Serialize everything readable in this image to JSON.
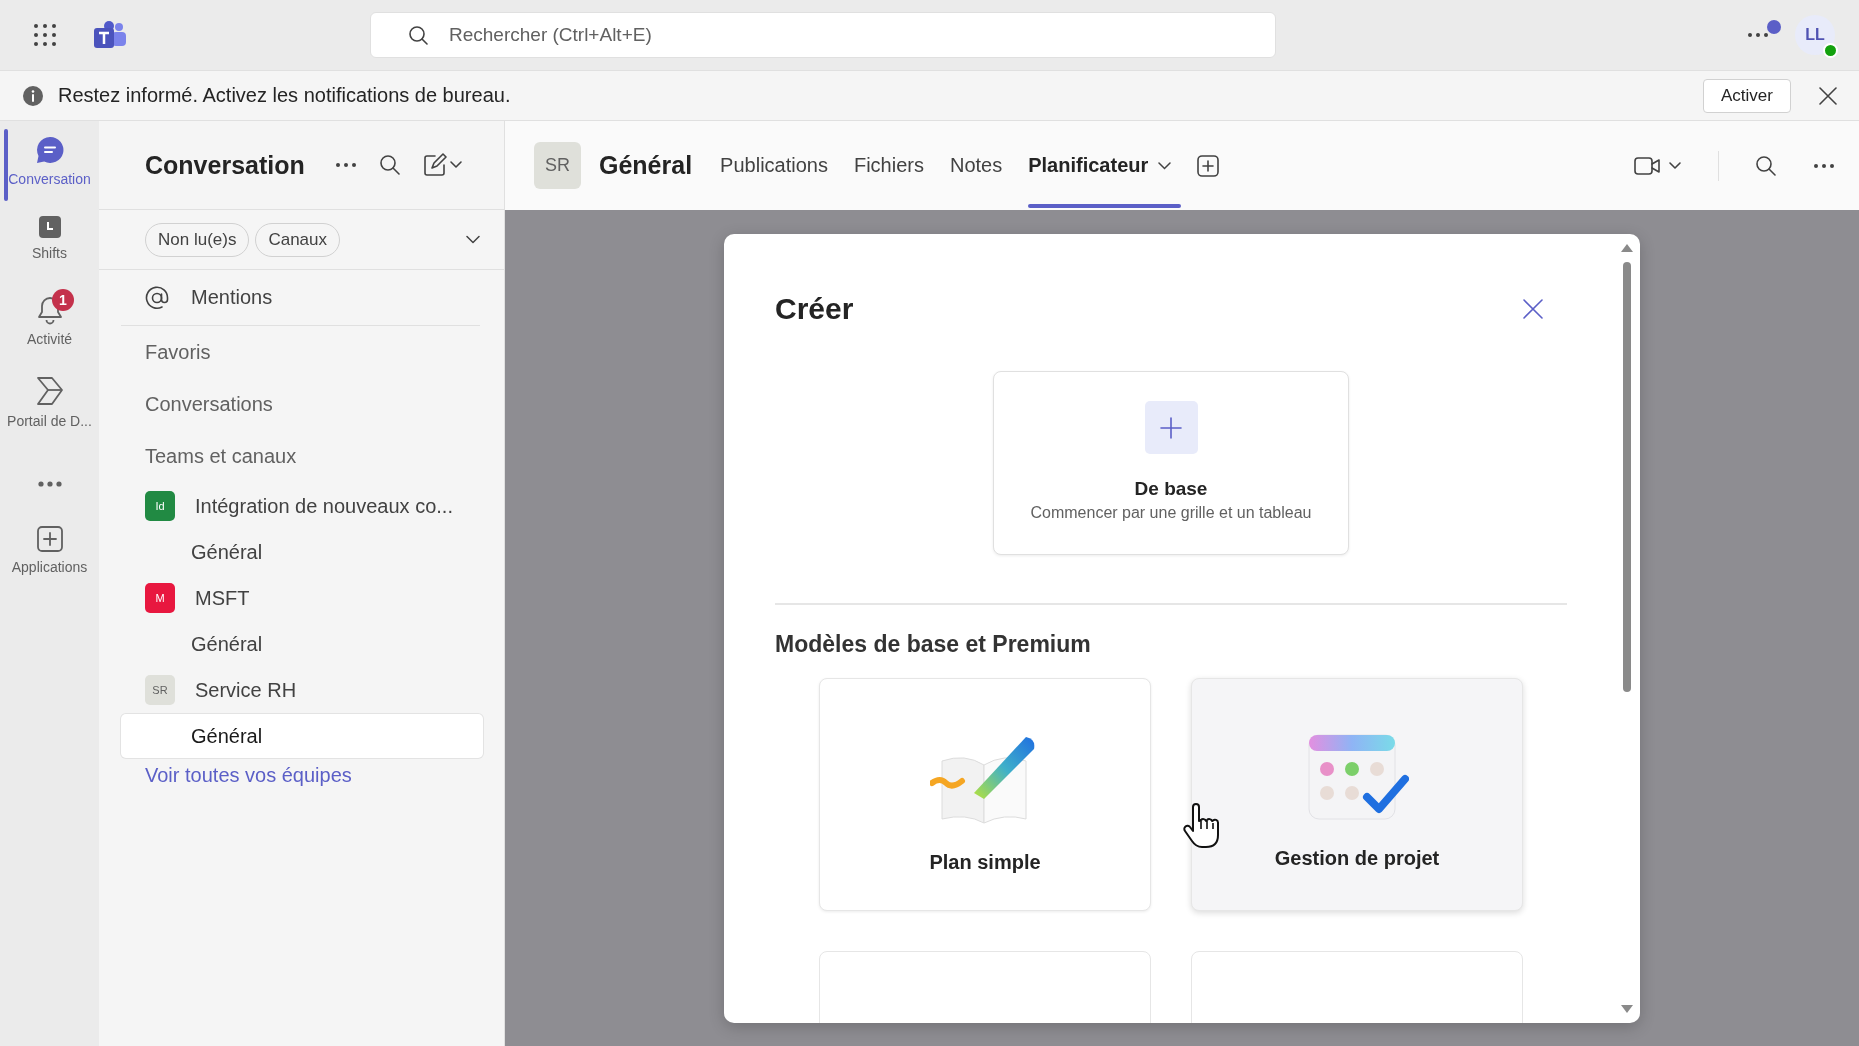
{
  "topbar": {
    "search": {
      "placeholder": "Rechercher (Ctrl+Alt+E)"
    },
    "more_unread": true,
    "avatar": {
      "initials": "LL",
      "online": true
    }
  },
  "notification": {
    "text": "Restez informé. Activez les notifications de bureau.",
    "button": "Activer"
  },
  "rail": [
    {
      "kind": "chat",
      "label": "Conversation",
      "selected": true
    },
    {
      "kind": "shifts",
      "label": "Shifts",
      "selected": false
    },
    {
      "kind": "activity",
      "label": "Activité",
      "selected": false,
      "badge": "1"
    },
    {
      "kind": "portal",
      "label": "Portail de D...",
      "selected": false
    },
    {
      "kind": "more",
      "selected": false
    },
    {
      "kind": "apps",
      "label": "Applications",
      "selected": false
    }
  ],
  "sidebar": {
    "title": "Conversation",
    "filters": [
      {
        "label": "Non lu(e)s",
        "selected": false
      },
      {
        "label": "Canaux",
        "selected": false
      }
    ],
    "mentions": "Mentions",
    "sections": [
      {
        "label": "Favoris"
      },
      {
        "label": "Conversations"
      },
      {
        "label": "Teams et canaux",
        "children": [
          {
            "initials": "Id",
            "name": "Intégration de nouveaux co...",
            "color": "#218a43",
            "children": [
              {
                "label": "Général",
                "selected": false
              }
            ]
          },
          {
            "initials": "M",
            "name": "MSFT",
            "color": "#e8173f",
            "children": [
              {
                "label": "Général",
                "selected": false
              }
            ]
          },
          {
            "initials": "SR",
            "name": "Service RH",
            "color": "#dfe0da",
            "children": [
              {
                "label": "Général",
                "selected": true
              }
            ]
          }
        ]
      }
    ],
    "link": "Voir toutes vos équipes"
  },
  "channel": {
    "avatar": "SR",
    "title": "Général",
    "tabs": [
      {
        "label": "Publications",
        "selected": false,
        "dropdown": false
      },
      {
        "label": "Fichiers",
        "selected": false,
        "dropdown": false
      },
      {
        "label": "Notes",
        "selected": false,
        "dropdown": false
      },
      {
        "label": "Planificateur",
        "selected": true,
        "dropdown": true
      }
    ]
  },
  "dialog": {
    "title": "Créer",
    "blank": {
      "title": "De base",
      "description": "Commencer par une grille et un tableau"
    },
    "section": "Modèles de base et Premium",
    "templates": [
      {
        "kind": "book",
        "label": "Plan simple",
        "hovered": false
      },
      {
        "kind": "calendar",
        "label": "Gestion de projet",
        "hovered": true
      }
    ]
  }
}
